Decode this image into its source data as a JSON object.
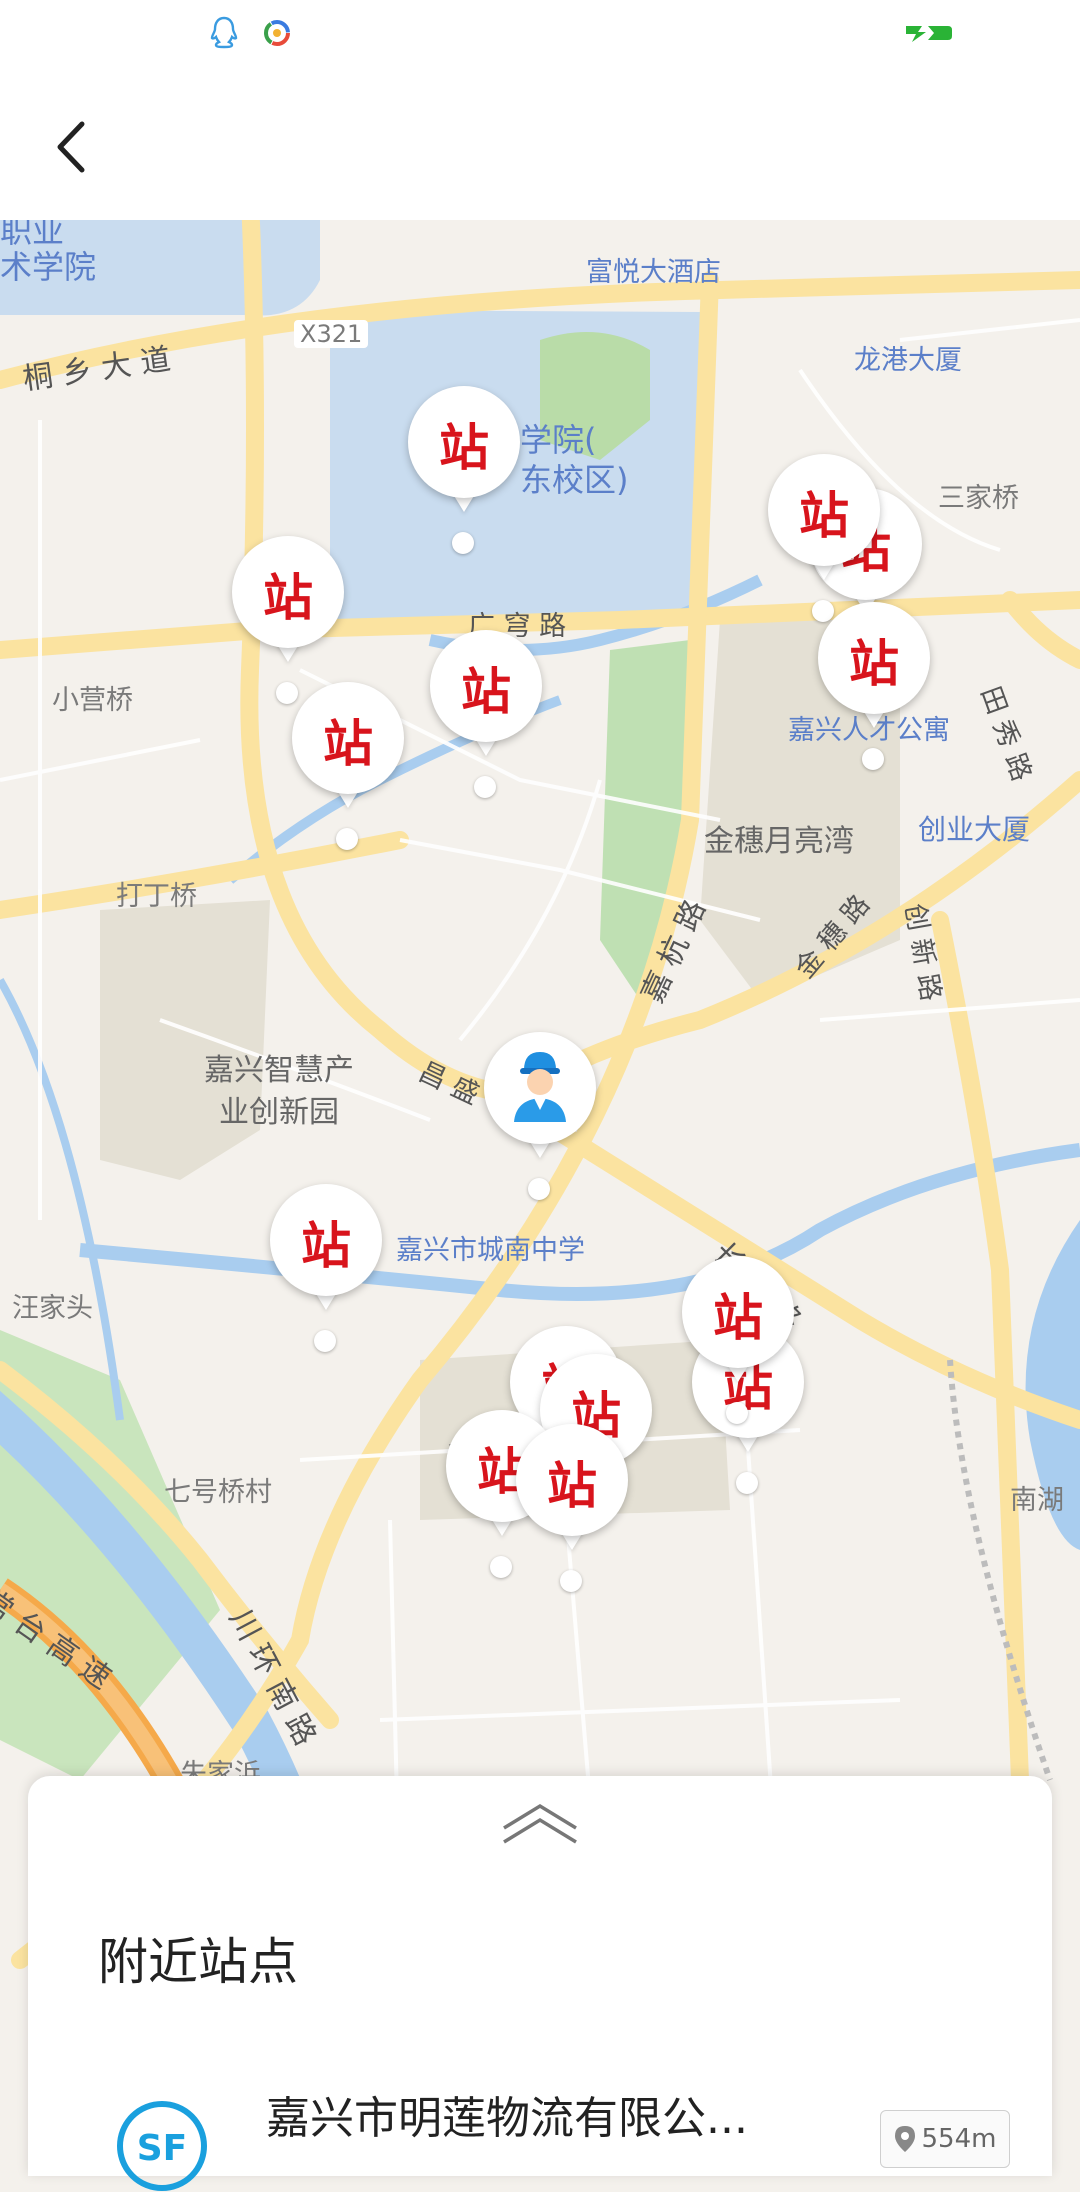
{
  "status_bar": {
    "icons": [
      "qq-icon",
      "browser-icon",
      "battery-charging-icon"
    ]
  },
  "nav": {
    "back_icon": "chevron-left-icon"
  },
  "map": {
    "labels": {
      "top_left_1": "职业",
      "top_left_2": "术学院",
      "hotel": "富悦大酒店",
      "road_x321": "X321",
      "road_tongxiang": "桐 乡 大 道",
      "longgang": "龙港大厦",
      "campus": "学院(\n东校区)",
      "sanjia": "三家桥",
      "guangqiong": "广 穹 路",
      "xiaoyingqiao": "小营桥",
      "apartment": "嘉兴人才公寓",
      "tianxiu": "田 秀 路",
      "jinsui_bay": "金穗月亮湾",
      "chuangye": "创业大厦",
      "dadingqiao": "打丁桥",
      "jinsui_road": "金 穗 路",
      "chuangxin_road": "创 新 路",
      "jiahang": "嘉 杭 路",
      "park": "嘉兴智慧产\n业创新园",
      "changsheng": "昌 盛",
      "school": "嘉兴市城南中学",
      "changshui": "长 水 路",
      "wangjiatou": "汪家头",
      "qihaoqiao": "七号桥村",
      "jinsui_small": "金穗",
      "changtai": "常 台 高 速",
      "chuanhuan": "川 环 南 路",
      "zhujiabang": "朱家浜",
      "nanhu": "南湖"
    },
    "station_glyph": "站",
    "courier_icon": "courier-avatar-icon",
    "station_count": 14
  },
  "sheet": {
    "handle_icon": "chevron-up-double-icon",
    "title": "附近站点",
    "stations": [
      {
        "name": "嘉兴市明莲物流有限公...",
        "distance": "554m",
        "logo_text": "SF"
      }
    ]
  },
  "colors": {
    "station_red": "#d8141c",
    "sf_blue": "#1aa0de",
    "campus_blue": "#c9dcef",
    "road_yellow": "#fbe3a0",
    "river": "#a9cdef",
    "highway_orange": "#f5a94a"
  }
}
